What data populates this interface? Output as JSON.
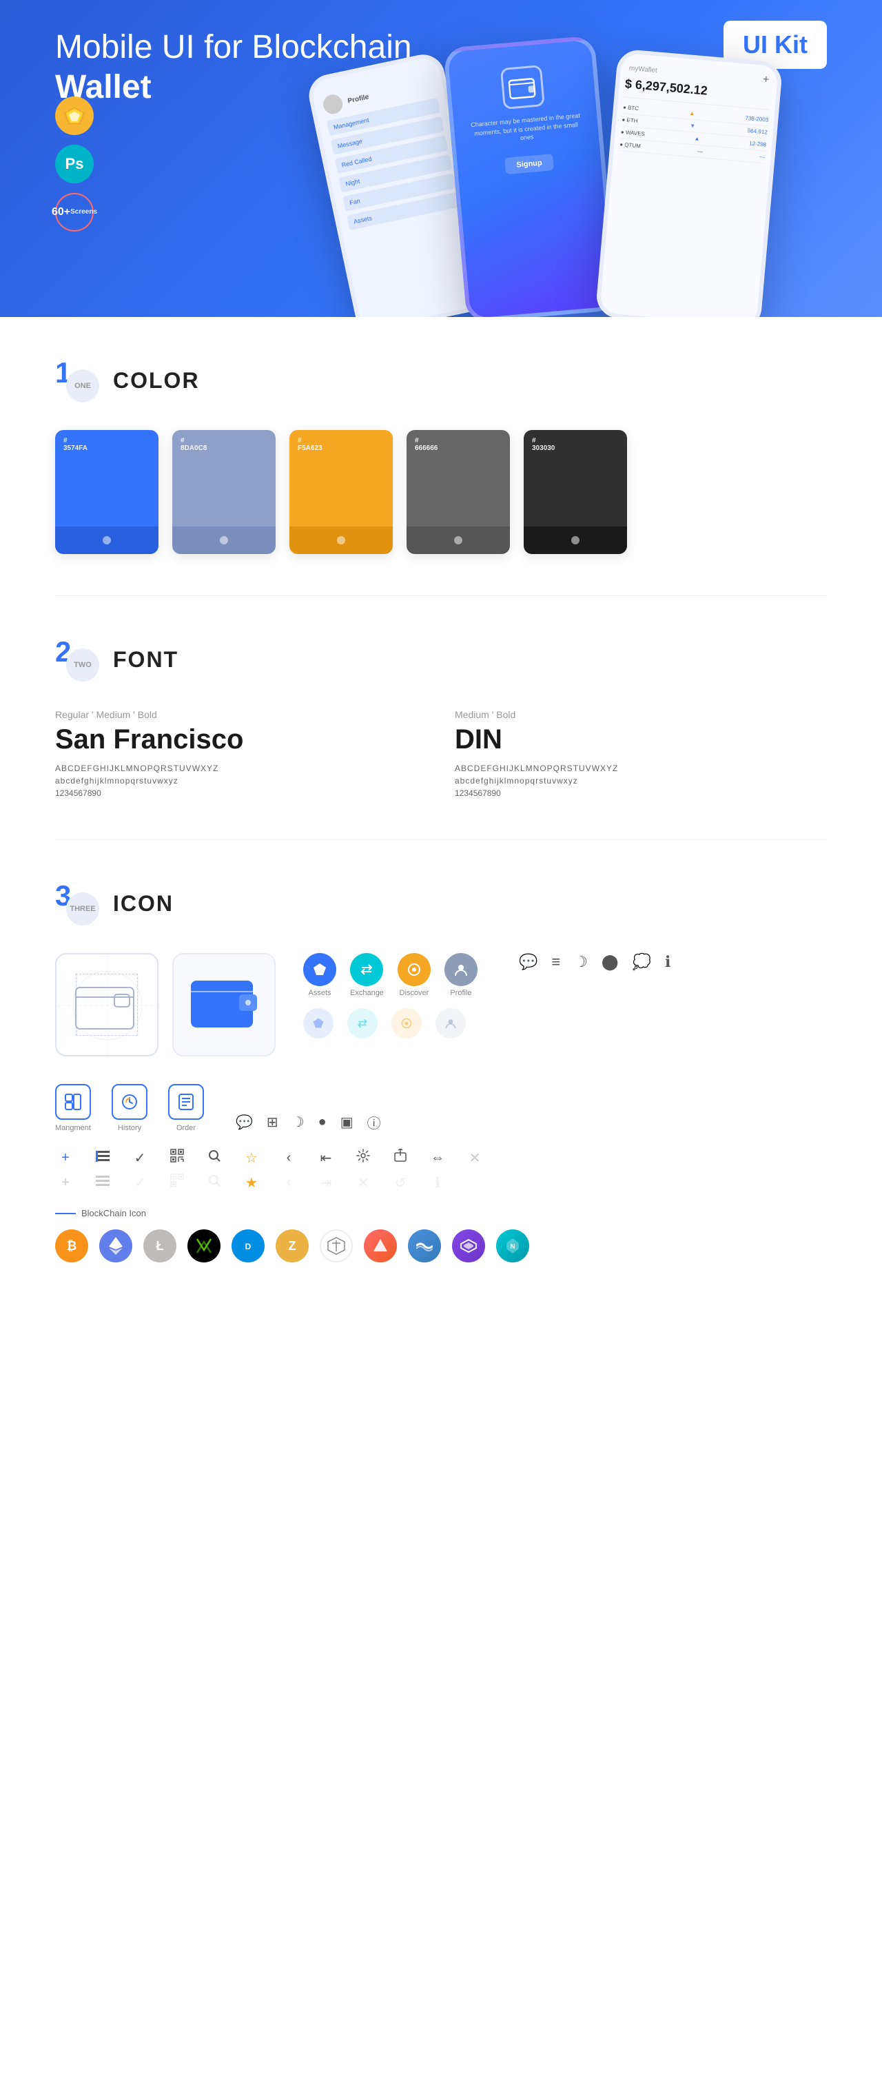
{
  "hero": {
    "title_normal": "Mobile UI for Blockchain ",
    "title_bold": "Wallet",
    "badge": "UI Kit",
    "sketch_label": "Sketch",
    "ps_label": "Ps",
    "screens_count": "60+",
    "screens_label": "Screens"
  },
  "sections": {
    "color": {
      "num": "1",
      "label": "ONE",
      "title": "COLOR",
      "swatches": [
        {
          "hex": "#3574FA",
          "display": "#\n3574FA"
        },
        {
          "hex": "#8DA0C8",
          "display": "#\n8DA0C8"
        },
        {
          "hex": "#F5A623",
          "display": "#\nF5A623"
        },
        {
          "hex": "#666666",
          "display": "#\n666666"
        },
        {
          "hex": "#303030",
          "display": "#\n303030"
        }
      ]
    },
    "font": {
      "num": "2",
      "label": "TWO",
      "title": "FONT",
      "font1": {
        "style": "Regular ' Medium ' Bold",
        "name": "San Francisco",
        "upper": "ABCDEFGHIJKLMNOPQRSTUVWXYZ",
        "lower": "abcdefghijklmnopqrstuvwxyz",
        "nums": "1234567890"
      },
      "font2": {
        "style": "Medium ' Bold",
        "name": "DIN",
        "upper": "ABCDEFGHIJKLMNOPQRSTUVWXYZ",
        "lower": "abcdefghijklmnopqrstuvwxyz",
        "nums": "1234567890"
      }
    },
    "icon": {
      "num": "3",
      "label": "THREE",
      "title": "ICON",
      "nav_icons": [
        {
          "label": "Assets",
          "symbol": "◆"
        },
        {
          "label": "Exchange",
          "symbol": "⇄"
        },
        {
          "label": "Discover",
          "symbol": "●"
        },
        {
          "label": "Profile",
          "symbol": "👤"
        }
      ],
      "app_icons": [
        {
          "label": "Mangment",
          "symbol": "▣"
        },
        {
          "label": "History",
          "symbol": "🕐"
        },
        {
          "label": "Order",
          "symbol": "📋"
        }
      ],
      "blockchain_label": "BlockChain Icon",
      "cryptos": [
        {
          "name": "Bitcoin",
          "symbol": "₿",
          "class": "crypto-btc"
        },
        {
          "name": "Ethereum",
          "symbol": "Ξ",
          "class": "crypto-eth"
        },
        {
          "name": "Litecoin",
          "symbol": "Ł",
          "class": "crypto-ltc"
        },
        {
          "name": "NEO",
          "symbol": "N",
          "class": "crypto-neo"
        },
        {
          "name": "Dash",
          "symbol": "D",
          "class": "crypto-dash"
        },
        {
          "name": "Zcash",
          "symbol": "Z",
          "class": "crypto-zcash"
        },
        {
          "name": "IOTA",
          "symbol": "⬡",
          "class": "crypto-iota"
        },
        {
          "name": "Ark",
          "symbol": "▲",
          "class": "crypto-ark"
        },
        {
          "name": "Waves",
          "symbol": "W",
          "class": "crypto-waves"
        },
        {
          "name": "Matic",
          "symbol": "M",
          "class": "crypto-matic"
        }
      ]
    }
  },
  "phone": {
    "balance": "$ 6,297,502.12",
    "label": "myWallet",
    "cryptos": [
      {
        "name": "BTC",
        "value": "738-2003"
      },
      {
        "name": "ETH",
        "value": "564,912"
      },
      {
        "name": "WAVES",
        "value": "12-298"
      },
      {
        "name": "QTUM",
        "value": "---"
      }
    ]
  }
}
